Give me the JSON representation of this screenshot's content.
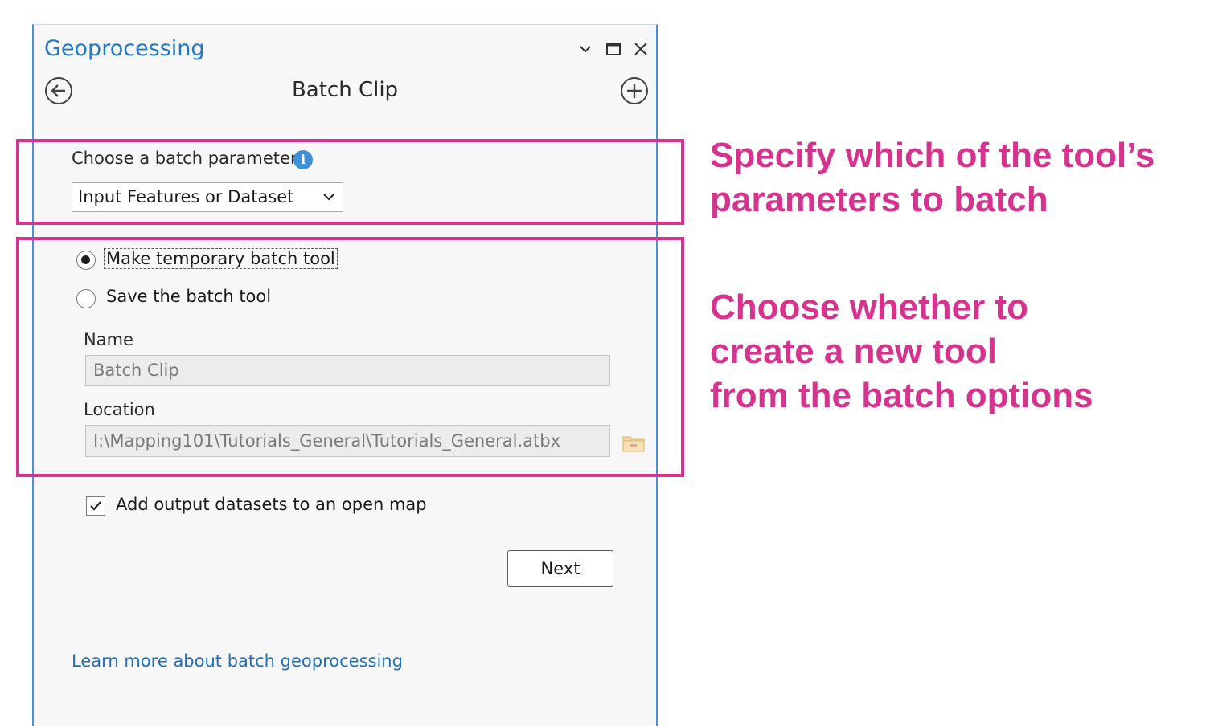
{
  "pane": {
    "title": "Geoprocessing",
    "tool_title": "Batch Clip"
  },
  "batch_parameter": {
    "label": "Choose a batch parameter",
    "selected": "Input Features or Dataset"
  },
  "options": {
    "temporary_label": "Make temporary batch tool",
    "save_label": "Save the batch tool",
    "selected": "temporary"
  },
  "name_field": {
    "label": "Name",
    "value": "Batch Clip"
  },
  "location_field": {
    "label": "Location",
    "value": "I:\\Mapping101\\Tutorials_General\\Tutorials_General.atbx"
  },
  "add_output": {
    "label": "Add output datasets to an open map",
    "checked": true
  },
  "next_label": "Next",
  "learn_more": "Learn more about batch geoprocessing",
  "annotations": {
    "top": "Specify which of the tool’s\nparameters to batch",
    "bottom": "Choose whether to\ncreate a new tool\nfrom the batch options"
  },
  "colors": {
    "accent": "#d6338f",
    "title_blue": "#1f78c8",
    "link_blue": "#1f6fb8"
  },
  "icons": [
    "chevron-down-icon",
    "maximize-icon",
    "close-icon",
    "back-arrow-icon",
    "add-plus-icon",
    "info-icon",
    "folder-icon",
    "checkmark-icon"
  ]
}
